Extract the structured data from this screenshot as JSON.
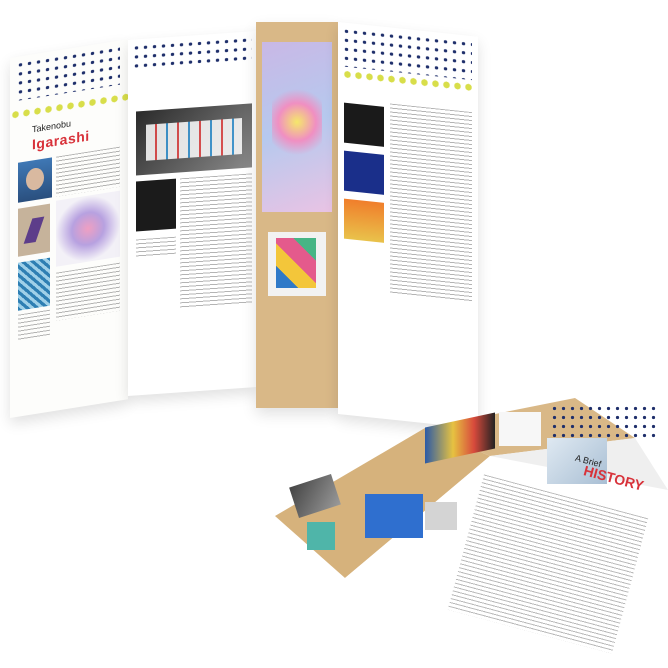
{
  "top_brochure": {
    "first_name": "Takenobu",
    "last_name": "Igarashi"
  },
  "bottom_brochure": {
    "prefix": "A Brief",
    "title": "HISTORY"
  },
  "colors": {
    "accent_red": "#d8323a",
    "navy_dots": "#1f2f6b",
    "yellow_dots": "#d8de4a",
    "kraft": "#d9b887"
  }
}
